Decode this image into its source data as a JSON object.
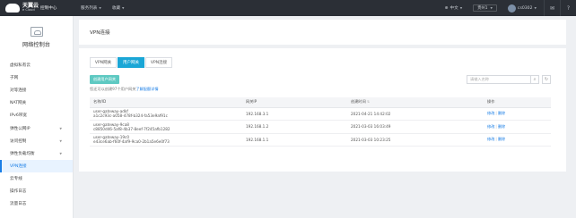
{
  "topbar": {
    "logo_cn": "天翼云",
    "logo_en": "e Cloud",
    "console": "控制中心",
    "nav": [
      "服务列表",
      "收藏"
    ],
    "language": "中文",
    "region": "贵州1",
    "user": "cs0302"
  },
  "sidebar": {
    "title": "网络控制台",
    "items": [
      {
        "label": "虚拟私有云",
        "caret": false
      },
      {
        "label": "子网",
        "caret": false
      },
      {
        "label": "对等连接",
        "caret": false
      },
      {
        "label": "NAT网关",
        "caret": false
      },
      {
        "label": "IPv6带宽",
        "caret": false
      },
      {
        "label": "弹性公网IP",
        "caret": true
      },
      {
        "label": "访问控制",
        "caret": true
      },
      {
        "label": "弹性负载均衡",
        "caret": true
      },
      {
        "label": "VPN连接",
        "caret": false,
        "active": true
      },
      {
        "label": "云专线",
        "caret": false
      },
      {
        "label": "操作日志",
        "caret": false
      },
      {
        "label": "流量日志",
        "caret": false
      }
    ]
  },
  "page": {
    "title": "VPN连接",
    "tabs": [
      {
        "label": "VPN网关",
        "active": false
      },
      {
        "label": "用户网关",
        "active": true
      },
      {
        "label": "VPN连接",
        "active": false
      }
    ],
    "create_button": "创建用户网关",
    "hint_prefix": "您还可以创建97个用户网关",
    "hint_link": "了解配额详情",
    "search_placeholder": "请输入名称",
    "table": {
      "headers": [
        "名称/ID",
        "网关IP",
        "创建时间",
        "操作"
      ],
      "rows": [
        {
          "name": "user-gateway-adkf",
          "id": "a1c2c93c-a058-478f-b324-fa53e9af91c",
          "ip": "192.168.3.1",
          "time": "2021-04-21 14:42:02",
          "modify": "修改",
          "delete": "删除"
        },
        {
          "name": "user-gateway-9ca8",
          "id": "c8850d46-5af8-4b37-8eef-7f245afb1282",
          "ip": "192.168.1.2",
          "time": "2021-03-03 16:03:49",
          "modify": "修改",
          "delete": "删除"
        },
        {
          "name": "user-gateway-19c0",
          "id": "e43ce6ab-f60f-4af9-9ca0-2b1a5e6e0f73",
          "ip": "192.168.1.1",
          "time": "2021-03-03 10:23:25",
          "modify": "修改",
          "delete": "删除"
        }
      ]
    }
  },
  "colors": {
    "topbar_bg": "#2b2f36",
    "accent": "#1aa6d6",
    "create_button": "#5ec9c2",
    "link": "#1a7ee6"
  },
  "icons": [
    "logo-cloud-icon",
    "caret-down-icon",
    "globe-icon",
    "avatar-icon",
    "message-icon",
    "help-icon",
    "search-icon",
    "refresh-icon",
    "sort-icon"
  ]
}
